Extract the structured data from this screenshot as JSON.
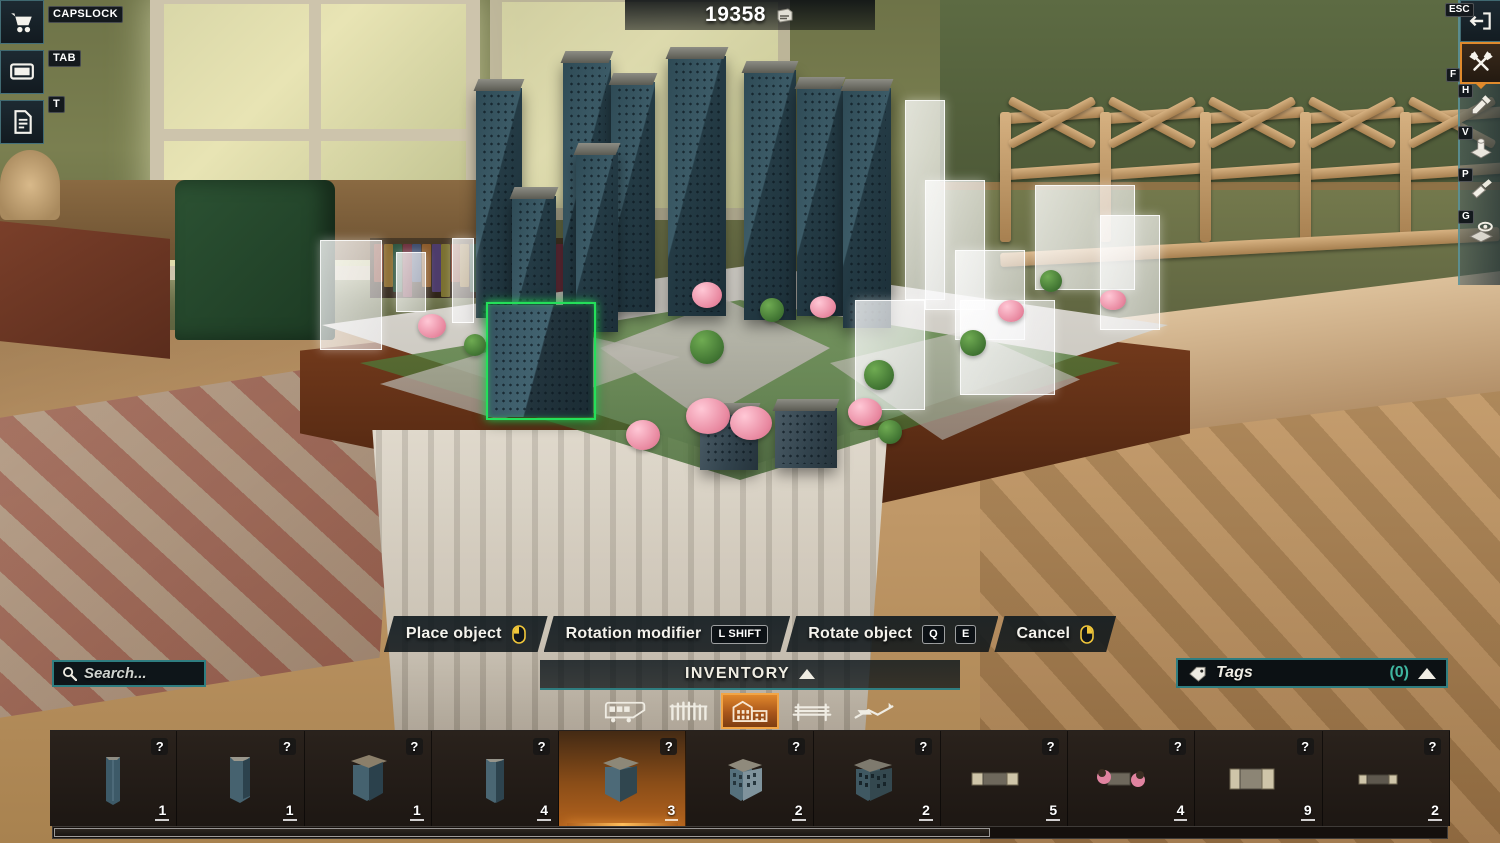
{
  "hud": {
    "currency": {
      "amount": "19358",
      "icon": "money-roll-icon"
    },
    "left_rail": [
      {
        "name": "shop-cart",
        "key": "CAPSLOCK",
        "icon": "shopping-cart-icon"
      },
      {
        "name": "screen",
        "key": "TAB",
        "icon": "monitor-icon"
      },
      {
        "name": "notes",
        "key": "T",
        "icon": "document-icon"
      }
    ],
    "right_rail": [
      {
        "name": "exit",
        "key": "ESC",
        "icon": "exit-arrow-icon",
        "active": false
      },
      {
        "name": "build-tools",
        "key": "F",
        "icon": "wrench-screwdriver-icon",
        "active": true
      },
      {
        "name": "picker",
        "key": "H",
        "icon": "eyedropper-icon",
        "active": false
      },
      {
        "name": "object-stamp",
        "key": "V",
        "icon": "object-3d-icon",
        "active": false
      },
      {
        "name": "paint",
        "key": "P",
        "icon": "paintbrush-icon",
        "active": false
      },
      {
        "name": "grid-visibility",
        "key": "G",
        "icon": "layers-eye-icon",
        "active": false
      }
    ],
    "hints": [
      {
        "label": "Place object",
        "key": "",
        "icon": "mouse-left-click-icon"
      },
      {
        "label": "Rotation modifier",
        "key": "L SHIFT",
        "icon": ""
      },
      {
        "label": "Rotate object",
        "key": "Q",
        "key2": "E",
        "icon": ""
      },
      {
        "label": "Cancel",
        "key": "",
        "icon": "mouse-right-click-icon"
      }
    ]
  },
  "search": {
    "placeholder": "Search...",
    "value": "",
    "icon": "search-icon"
  },
  "inventory": {
    "title": "INVENTORY",
    "collapse_icon": "triangle-up-icon",
    "categories": [
      {
        "name": "vehicles",
        "icon": "tram-icon",
        "selected": false
      },
      {
        "name": "fences",
        "icon": "fence-icon",
        "selected": false
      },
      {
        "name": "buildings",
        "icon": "building-icon",
        "selected": true
      },
      {
        "name": "furniture",
        "icon": "bench-icon",
        "selected": false
      },
      {
        "name": "terrain",
        "icon": "landscape-icon",
        "selected": false
      }
    ],
    "slots": [
      {
        "name": "tower-slim-a",
        "qty": "1",
        "info": "?",
        "selected": false,
        "thumb": "tower-slim"
      },
      {
        "name": "tower-slim-b",
        "qty": "1",
        "info": "?",
        "selected": false,
        "thumb": "tower-block"
      },
      {
        "name": "tower-wide-a",
        "qty": "1",
        "info": "?",
        "selected": false,
        "thumb": "tower-roofed"
      },
      {
        "name": "tower-tall-a",
        "qty": "4",
        "info": "?",
        "selected": false,
        "thumb": "tower-plain"
      },
      {
        "name": "tower-square-a",
        "qty": "3",
        "info": "?",
        "selected": true,
        "thumb": "tower-square"
      },
      {
        "name": "apartment-a",
        "qty": "2",
        "info": "?",
        "selected": false,
        "thumb": "apartment"
      },
      {
        "name": "apartment-b",
        "qty": "2",
        "info": "?",
        "selected": false,
        "thumb": "apartment-dark"
      },
      {
        "name": "pavement-a",
        "qty": "5",
        "info": "?",
        "selected": false,
        "thumb": "pavement"
      },
      {
        "name": "pavement-blossom",
        "qty": "4",
        "info": "?",
        "selected": false,
        "thumb": "pavement-blossom"
      },
      {
        "name": "pavement-wide",
        "qty": "9",
        "info": "?",
        "selected": false,
        "thumb": "pavement-wide"
      },
      {
        "name": "pavement-narrow",
        "qty": "2",
        "info": "?",
        "selected": false,
        "thumb": "pavement-narrow"
      }
    ],
    "scrollbar": {
      "name": "inventory-scrollbar"
    }
  },
  "tags": {
    "label": "Tags",
    "count": "(0)",
    "icon": "tag-icon",
    "collapse_icon": "triangle-up-icon"
  },
  "colors": {
    "accent_orange": "#e0872b",
    "accent_teal": "#2f7d80",
    "tag_count_teal": "#3fb6a0",
    "selection_green": "#24e05a",
    "panel_dark": "#1a1512"
  }
}
